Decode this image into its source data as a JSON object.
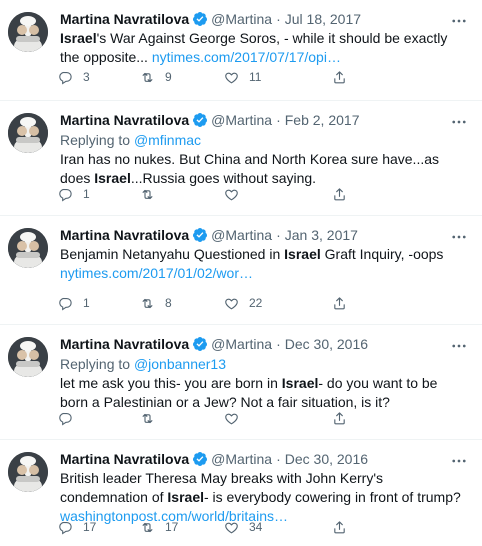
{
  "tweets": [
    {
      "name": "Martina Navratilova",
      "handle": "@Martina",
      "separator": "·",
      "date": "Jul 18, 2017",
      "reply_prefix": "",
      "reply_handle": "",
      "text": [
        {
          "t": "Israel",
          "s": "bold"
        },
        {
          "t": "'s War Against George Soros, - while it should be exactly the opposite... ",
          "s": "plain"
        },
        {
          "t": "nytimes.com/2017/07/17/opi…",
          "s": "link"
        }
      ],
      "replies": "3",
      "retweets": "9",
      "likes": "11"
    },
    {
      "name": "Martina Navratilova",
      "handle": "@Martina",
      "separator": "·",
      "date": "Feb 2, 2017",
      "reply_prefix": "Replying to ",
      "reply_handle": "@mfinmac",
      "text": [
        {
          "t": "Iran has no nukes. But China and North Korea sure have...as does ",
          "s": "plain"
        },
        {
          "t": "Israel",
          "s": "bold"
        },
        {
          "t": "...Russia goes without saying.",
          "s": "plain"
        }
      ],
      "replies": "1",
      "retweets": "",
      "likes": ""
    },
    {
      "name": "Martina Navratilova",
      "handle": "@Martina",
      "separator": "·",
      "date": "Jan 3, 2017",
      "reply_prefix": "",
      "reply_handle": "",
      "text": [
        {
          "t": "Benjamin Netanyahu Questioned in ",
          "s": "plain"
        },
        {
          "t": "Israel",
          "s": "bold"
        },
        {
          "t": " Graft Inquiry, -oops ",
          "s": "plain"
        },
        {
          "t": "nytimes.com/2017/01/02/wor…",
          "s": "link"
        }
      ],
      "replies": "1",
      "retweets": "8",
      "likes": "22"
    },
    {
      "name": "Martina Navratilova",
      "handle": "@Martina",
      "separator": "·",
      "date": "Dec 30, 2016",
      "reply_prefix": "Replying to ",
      "reply_handle": "@jonbanner13",
      "text": [
        {
          "t": "let me ask you this- you are born in ",
          "s": "plain"
        },
        {
          "t": "Israel",
          "s": "bold"
        },
        {
          "t": "- do you want to be born a Palestinian or a Jew? Not a fair situation, is it?",
          "s": "plain"
        }
      ],
      "replies": "",
      "retweets": "",
      "likes": ""
    },
    {
      "name": "Martina Navratilova",
      "handle": "@Martina",
      "separator": "·",
      "date": "Dec 30, 2016",
      "reply_prefix": "",
      "reply_handle": "",
      "text": [
        {
          "t": "British leader Theresa May breaks with John Kerry's condemnation of ",
          "s": "plain"
        },
        {
          "t": "Israel",
          "s": "bold"
        },
        {
          "t": "- is everybody cowering in front of trump? ",
          "s": "plain"
        },
        {
          "t": "washingtonpost.com/world/britains…",
          "s": "link"
        }
      ],
      "replies": "17",
      "retweets": "17",
      "likes": "34"
    }
  ],
  "icons": {
    "verified": "verified-badge-icon",
    "more": "more-dots-icon",
    "reply": "reply-bubble-icon",
    "retweet": "retweet-icon",
    "like": "heart-icon",
    "share": "share-icon"
  },
  "colors": {
    "accent": "#1d9bf0",
    "text": "#0f1419",
    "muted": "#536471",
    "divider": "#eff3f4"
  }
}
